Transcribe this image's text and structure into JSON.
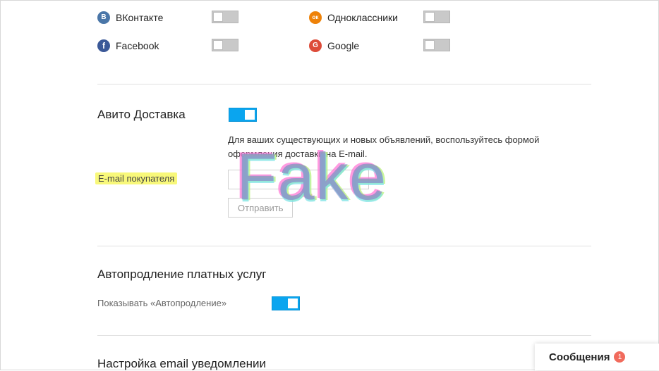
{
  "social_links": [
    {
      "name": "ВКонтакте",
      "icon": "vk-icon",
      "icon_glyph": "В",
      "color": "#4a76a8",
      "enabled": false
    },
    {
      "name": "Одноклассники",
      "icon": "odnoklassniki-icon",
      "icon_glyph": "ок",
      "color": "#ee8208",
      "enabled": false
    },
    {
      "name": "Facebook",
      "icon": "facebook-icon",
      "icon_glyph": "f",
      "color": "#3b5998",
      "enabled": false
    },
    {
      "name": "Google",
      "icon": "google-icon",
      "icon_glyph": "G",
      "color": "#dd4b39",
      "enabled": false
    }
  ],
  "delivery": {
    "title": "Авито Доставка",
    "enabled": true,
    "description": "Для ваших существующих и новых объявлений, воспользуйтесь формой оформления доставки на E-mail.",
    "email_label": "E-mail покупателя",
    "email_value": "",
    "send_label": "Отправить"
  },
  "autorenew": {
    "title": "Автопродление платных услуг",
    "show_label": "Показывать «Автопродление»",
    "enabled": true
  },
  "notifications": {
    "title": "Настройка email уведомлении"
  },
  "watermark": {
    "text": "Fake",
    "colors": [
      "#ff7ad6",
      "#7fe4e6",
      "#b8f27a",
      "#8a92c8"
    ]
  },
  "messages": {
    "label": "Сообщения",
    "count": "1"
  }
}
